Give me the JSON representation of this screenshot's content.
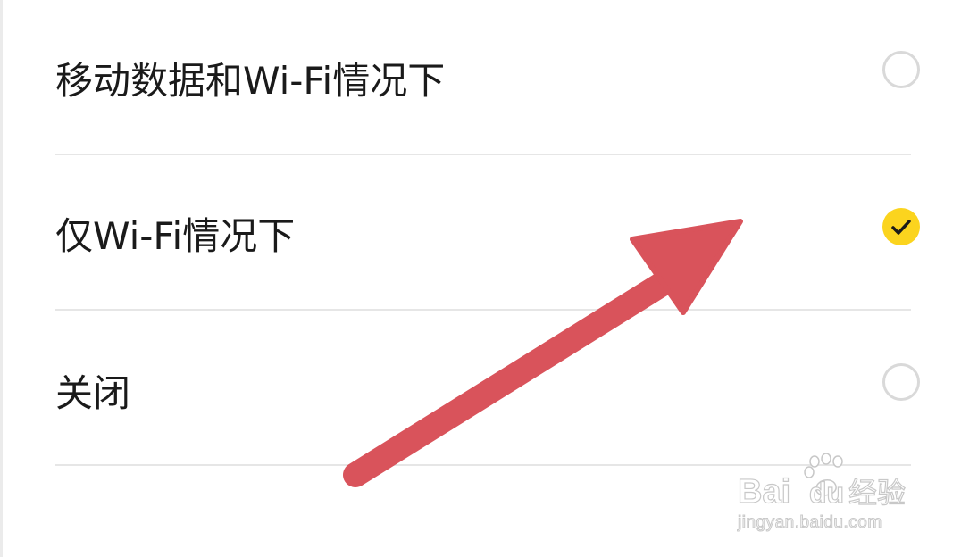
{
  "options": [
    {
      "label": "移动数据和Wi-Fi情况下",
      "selected": false
    },
    {
      "label": "仅Wi-Fi情况下",
      "selected": true
    },
    {
      "label": "关闭",
      "selected": false
    }
  ],
  "colors": {
    "selected_radio": "#fbd41e",
    "arrow": "#d9535b",
    "divider": "#e6e6e6"
  },
  "watermark": {
    "logo_text": "Baidu经验",
    "url": "jingyan.baidu.com"
  }
}
